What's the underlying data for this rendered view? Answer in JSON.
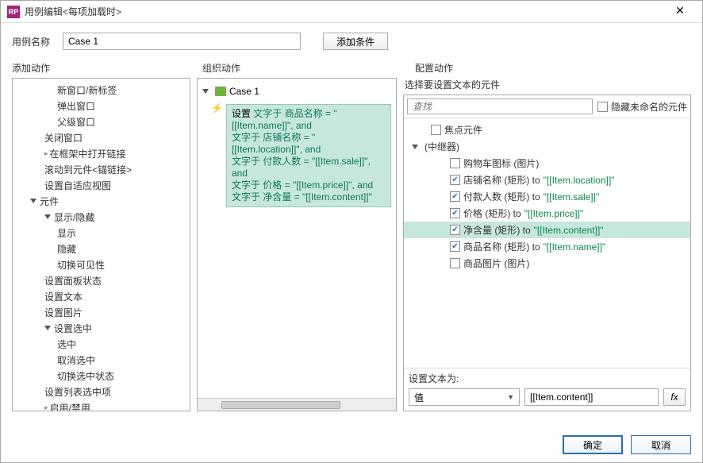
{
  "titlebar": {
    "icon_text": "RP",
    "title": "用例编辑<每项加载时>"
  },
  "case_label": "用例名称",
  "case_name": "Case 1",
  "add_condition": "添加条件",
  "col_headers": {
    "a": "添加动作",
    "b": "组织动作",
    "c": "配置动作"
  },
  "left_tree": [
    {
      "label": "新窗口/新标签",
      "depth": 1
    },
    {
      "label": "弹出窗口",
      "depth": 1
    },
    {
      "label": "父级窗口",
      "depth": 1
    },
    {
      "label": "关闭窗口",
      "depth": 0,
      "group_item": true
    },
    {
      "label": "在框架中打开链接",
      "depth": 0,
      "arrow": true
    },
    {
      "label": "滚动到元件<锚链接>",
      "depth": 0
    },
    {
      "label": "设置自适应视图",
      "depth": 0
    },
    {
      "label": "元件",
      "group": true,
      "depth": -1
    },
    {
      "label": "显示/隐藏",
      "group": true,
      "depth": 0
    },
    {
      "label": "显示",
      "depth": 1
    },
    {
      "label": "隐藏",
      "depth": 1
    },
    {
      "label": "切换可见性",
      "depth": 1
    },
    {
      "label": "设置面板状态",
      "depth": 0
    },
    {
      "label": "设置文本",
      "depth": 0
    },
    {
      "label": "设置图片",
      "depth": 0
    },
    {
      "label": "设置选中",
      "group": true,
      "depth": 0
    },
    {
      "label": "选中",
      "depth": 1
    },
    {
      "label": "取消选中",
      "depth": 1
    },
    {
      "label": "切换选中状态",
      "depth": 1
    },
    {
      "label": "设置列表选中项",
      "depth": 0
    },
    {
      "label": "启用/禁用",
      "depth": 0,
      "arrow": true
    }
  ],
  "mid": {
    "case_label": "Case 1",
    "action_prefix": "设置",
    "lines": [
      "文字于 商品名称 = \"[[Item.name]]\", and",
      "文字于 店铺名称 = \"[[Item.location]]\", and",
      "文字于 付款人数 = \"[[Item.sale]]\", and",
      "文字于 价格 = \"[[Item.price]]\", and",
      "文字于 净含量 = \"[[Item.content]]\""
    ]
  },
  "right": {
    "title": "选择要设置文本的元件",
    "search_placeholder": "查找",
    "hide_unnamed": "隐藏未命名的元件",
    "items": [
      {
        "label": "焦点元件",
        "checked": false,
        "depth": 1
      },
      {
        "label": "(中继器)",
        "group": true,
        "depth": 0
      },
      {
        "label": "购物车图标 (图片)",
        "checked": false,
        "depth": 2
      },
      {
        "label": "店铺名称 (矩形) to ",
        "value": "\"[[Item.location]]\"",
        "checked": true,
        "depth": 2
      },
      {
        "label": "付款人数 (矩形) to ",
        "value": "\"[[Item.sale]]\"",
        "checked": true,
        "depth": 2
      },
      {
        "label": "价格 (矩形) to ",
        "value": "\"[[Item.price]]\"",
        "checked": true,
        "depth": 2
      },
      {
        "label": "净含量 (矩形) to ",
        "value": "\"[[Item.content]]\"",
        "checked": true,
        "depth": 2,
        "selected": true
      },
      {
        "label": "商品名称 (矩形) to ",
        "value": "\"[[Item.name]]\"",
        "checked": true,
        "depth": 2
      },
      {
        "label": "商品图片 (图片)",
        "checked": false,
        "depth": 2
      }
    ],
    "set_label": "设置文本为:",
    "combo_value": "值",
    "input_value": "[[Item.content]]",
    "fx": "fx"
  },
  "footer": {
    "ok": "确定",
    "cancel": "取消"
  }
}
